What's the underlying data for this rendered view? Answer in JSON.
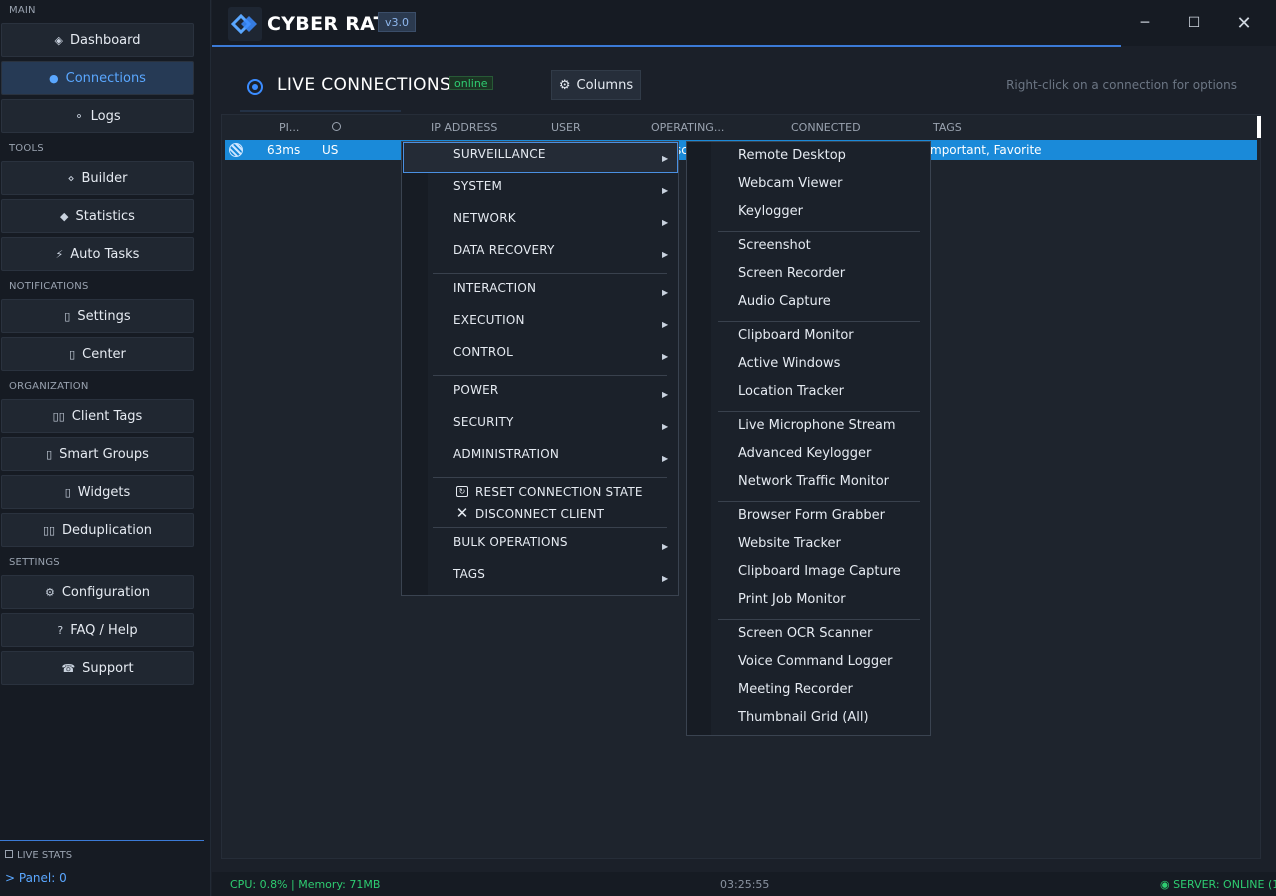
{
  "app": {
    "title": "CYBER RAT",
    "version": "v3.0"
  },
  "window_controls": {
    "minimize": "─",
    "maximize": "☐",
    "close": "✕"
  },
  "sidebar": {
    "sections": {
      "main": "MAIN",
      "tools": "TOOLS",
      "notifications": "NOTIFICATIONS",
      "organization": "ORGANIZATION",
      "settings": "SETTINGS"
    },
    "items": {
      "dashboard": "Dashboard",
      "connections": "Connections",
      "logs": "Logs",
      "builder": "Builder",
      "statistics": "Statistics",
      "auto_tasks": "Auto Tasks",
      "settings": "Settings",
      "center": "Center",
      "client_tags": "Client Tags",
      "smart_groups": "Smart Groups",
      "widgets": "Widgets",
      "deduplication": "Deduplication",
      "configuration": "Configuration",
      "faq": "FAQ / Help",
      "support": "Support"
    },
    "icons": {
      "dashboard": "◈",
      "connections": "●",
      "logs": "⚬",
      "builder": "⋄",
      "statistics": "◆",
      "auto_tasks": "⚡",
      "settings": "▯",
      "center": "▯",
      "client_tags": "▯▯",
      "smart_groups": "▯",
      "widgets": "▯",
      "deduplication": "▯▯",
      "configuration": "⚙",
      "faq": "?",
      "support": "☎"
    },
    "live_stats_label": "LIVE STATS",
    "panel_count": "> Panel: 0"
  },
  "main": {
    "title": "LIVE CONNECTIONS",
    "status_badge": "online",
    "columns_button": "Columns",
    "hint": "Right-click on a connection for options"
  },
  "table": {
    "headers": {
      "ping": "PI...",
      "country": "",
      "ip": "IP ADDRESS",
      "user": "USER",
      "os": "OPERATING...",
      "connected": "CONNECTED",
      "tags": "TAGS"
    },
    "row": {
      "ping": "63ms",
      "country": "US",
      "os_fragment": "sc",
      "tags": "mportant, Favorite"
    }
  },
  "context_menu": {
    "items": {
      "surveillance": "SURVEILLANCE",
      "system": "SYSTEM",
      "network": "NETWORK",
      "data_recovery": "DATA RECOVERY",
      "interaction": "INTERACTION",
      "execution": "EXECUTION",
      "control": "CONTROL",
      "power": "POWER",
      "security": "SECURITY",
      "administration": "ADMINISTRATION",
      "reset": "RESET CONNECTION STATE",
      "disconnect": "DISCONNECT CLIENT",
      "bulk": "BULK OPERATIONS",
      "tags": "TAGS"
    }
  },
  "submenu": {
    "items": {
      "remote_desktop": "Remote Desktop",
      "webcam_viewer": "Webcam Viewer",
      "keylogger": "Keylogger",
      "screenshot": "Screenshot",
      "screen_recorder": "Screen Recorder",
      "audio_capture": "Audio Capture",
      "clipboard_monitor": "Clipboard Monitor",
      "active_windows": "Active Windows",
      "location_tracker": "Location Tracker",
      "live_mic": "Live Microphone Stream",
      "adv_keylogger": "Advanced Keylogger",
      "net_traffic": "Network Traffic Monitor",
      "form_grabber": "Browser Form Grabber",
      "website_tracker": "Website Tracker",
      "clip_image": "Clipboard Image Capture",
      "print_job": "Print Job Monitor",
      "ocr": "Screen OCR Scanner",
      "voice_cmd": "Voice Command Logger",
      "meeting": "Meeting Recorder",
      "thumb_grid": "Thumbnail Grid (All)"
    }
  },
  "statusbar": {
    "left": "CPU: 0.8% | Memory: 71MB",
    "time": "03:25:55",
    "right": "◉ SERVER: ONLINE (1"
  },
  "colors": {
    "accent": "#3b8cff",
    "selection": "#1a8ad9",
    "online": "#2ecc71"
  }
}
